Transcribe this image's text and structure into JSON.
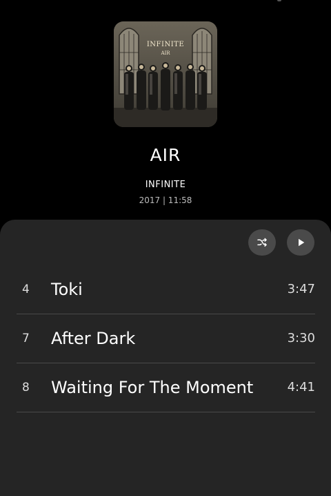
{
  "album": {
    "cover_title": "INFINITE",
    "cover_subtitle": "AIR",
    "title": "AIR",
    "artist": "INFINITE",
    "meta": "2017 | 11:58"
  },
  "controls": {
    "shuffle_icon": "shuffle-icon",
    "play_icon": "play-icon"
  },
  "tracks": [
    {
      "number": "4",
      "title": "Toki",
      "duration": "3:47"
    },
    {
      "number": "7",
      "title": "After Dark",
      "duration": "3:30"
    },
    {
      "number": "8",
      "title": "Waiting For The Moment",
      "duration": "4:41"
    }
  ],
  "colors": {
    "background": "#000000",
    "sheet": "#252525",
    "button": "#4a4a4a",
    "divider": "#4a4a4a"
  }
}
